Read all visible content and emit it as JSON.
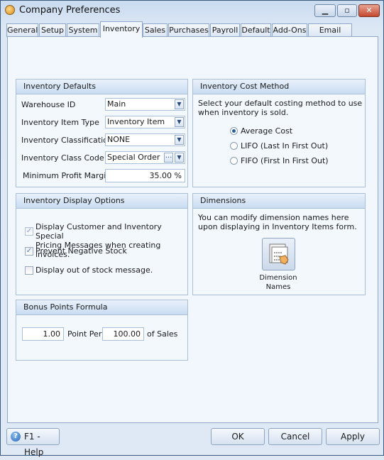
{
  "window": {
    "title": "Company Preferences",
    "icon": "app-logo-icon",
    "controls": {
      "minimize": "minimize-icon",
      "maximize": "maximize-icon",
      "close": "close-icon"
    }
  },
  "tabs": [
    {
      "label": "General"
    },
    {
      "label": "Setup"
    },
    {
      "label": "System"
    },
    {
      "label": "Inventory",
      "active": true
    },
    {
      "label": "Sales"
    },
    {
      "label": "Purchases"
    },
    {
      "label": "Payroll"
    },
    {
      "label": "Default"
    },
    {
      "label": "Add-Ons"
    },
    {
      "label": "Email Setup"
    }
  ],
  "inventory_defaults": {
    "title": "Inventory Defaults",
    "warehouse_id": {
      "label": "Warehouse ID",
      "value": "Main"
    },
    "item_type": {
      "label": "Inventory Item Type",
      "value": "Inventory Item"
    },
    "classification": {
      "label": "Inventory Classification",
      "value": "NONE"
    },
    "class_code": {
      "label": "Inventory Class Code",
      "value": "Special Order",
      "browse": "..."
    },
    "min_profit": {
      "label": "Minimum Profit Margin",
      "value": "35.00 %"
    }
  },
  "cost_method": {
    "title": "Inventory Cost Method",
    "description": "Select your default costing method to use when inventory is sold.",
    "options": [
      {
        "label": "Average Cost",
        "selected": true
      },
      {
        "label": "LIFO (Last In First Out)",
        "selected": false
      },
      {
        "label": "FIFO (First In First Out)",
        "selected": false
      }
    ]
  },
  "display_options": {
    "title": "Inventory Display Options",
    "items": [
      {
        "label1": "Display Customer and Inventory Special",
        "label2": "Pricing Messages when creating invoices.",
        "checked": true,
        "disabled": true
      },
      {
        "label1": "Prevent Negative Stock",
        "checked": true
      },
      {
        "label1": "Display out of stock message.",
        "checked": false
      }
    ]
  },
  "dimensions": {
    "title": "Dimensions",
    "description": "You can modify dimension names here upon displaying in Inventory Items form.",
    "button_line1": "Dimension",
    "button_line2": "Names"
  },
  "bonus": {
    "title": "Bonus Points Formula",
    "points": "1.00",
    "point_per": "Point Per",
    "amount": "100.00",
    "of_sales": "of Sales"
  },
  "footer": {
    "help": "F1 - Help",
    "ok": "OK",
    "cancel": "Cancel",
    "apply": "Apply"
  }
}
